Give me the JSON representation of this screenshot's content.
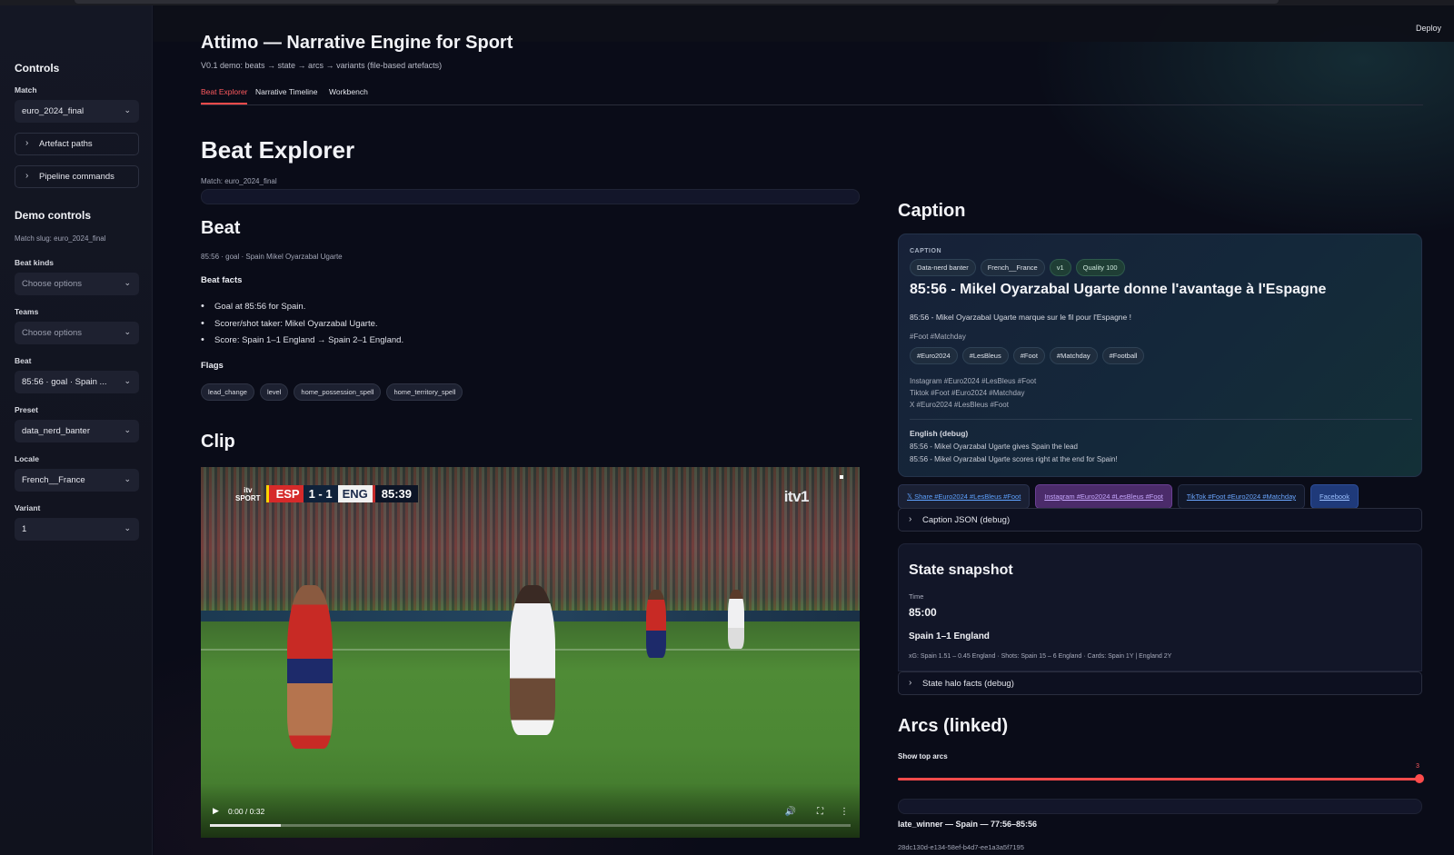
{
  "header": {
    "deploy_label": "Deploy"
  },
  "sidebar": {
    "controls_heading": "Controls",
    "match_label": "Match",
    "match_value": "euro_2024_final",
    "artefact_paths": "Artefact paths",
    "pipeline_commands": "Pipeline commands",
    "demo_heading": "Demo controls",
    "match_slug": "Match slug: euro_2024_final",
    "beat_kinds_label": "Beat kinds",
    "beat_kinds_placeholder": "Choose options",
    "teams_label": "Teams",
    "teams_placeholder": "Choose options",
    "beat_label": "Beat",
    "beat_value": "85:56 · goal · Spain ...",
    "preset_label": "Preset",
    "preset_value": "data_nerd_banter",
    "locale_label": "Locale",
    "locale_value": "French__France",
    "variant_label": "Variant",
    "variant_value": "1"
  },
  "app": {
    "title": "Attimo — Narrative Engine for Sport",
    "subtitle": "V0.1 demo: beats → state → arcs → variants (file-based artefacts)",
    "tabs": [
      "Beat Explorer",
      "Narrative Timeline",
      "Workbench"
    ],
    "active_tab": "Beat Explorer"
  },
  "explorer": {
    "heading": "Beat Explorer",
    "match_caption": "Match: euro_2024_final",
    "beat_heading": "Beat",
    "beat_caption": "85:56 · goal · Spain Mikel Oyarzabal Ugarte",
    "facts_label": "Beat facts",
    "facts": [
      "Goal at 85:56 for Spain.",
      "Scorer/shot taker: Mikel Oyarzabal Ugarte.",
      "Score: Spain 1–1 England → Spain 2–1 England."
    ],
    "flags_label": "Flags",
    "flags": [
      "lead_change",
      "level",
      "home_possession_spell",
      "home_territory_spell"
    ],
    "clip_heading": "Clip"
  },
  "video": {
    "brand_top": "itv",
    "brand_bottom": "SPORT",
    "team_home": "ESP",
    "score": "1 - 1",
    "team_away": "ENG",
    "clock": "85:39",
    "channel": "itv1",
    "time": "0:00 / 0:32",
    "progress": 0.11
  },
  "caption": {
    "heading": "Caption",
    "kicker": "CAPTION",
    "tags": [
      "Data-nerd banter",
      "French__France",
      "v1",
      "Quality 100"
    ],
    "title": "85:56 - Mikel Oyarzabal Ugarte donne l'avantage à l'Espagne",
    "body": "85:56 - Mikel Oyarzabal Ugarte marque sur le fil pour l'Espagne !",
    "hashline": "#Foot #Matchday",
    "hashtags": [
      "#Euro2024",
      "#LesBleus",
      "#Foot",
      "#Matchday",
      "#Football"
    ],
    "platforms": [
      "Instagram #Euro2024 #LesBleus #Foot",
      "Tiktok #Foot #Euro2024 #Matchday",
      "X #Euro2024 #LesBleus #Foot"
    ],
    "english_label": "English (debug)",
    "english": [
      "85:56 - Mikel Oyarzabal Ugarte gives Spain the lead",
      "85:56 - Mikel Oyarzabal Ugarte scores right at the end for Spain!"
    ],
    "share": {
      "x": "𝕏 Share #Euro2024 #LesBleus #Foot",
      "instagram": "Instagram #Euro2024 #LesBleus #Foot",
      "tiktok": "TikTok #Foot #Euro2024 #Matchday",
      "facebook": "Facebook"
    },
    "json_debug": "Caption JSON (debug)"
  },
  "state": {
    "heading": "State snapshot",
    "time_label": "Time",
    "time_value": "85:00",
    "score_line": "Spain 1–1 England",
    "stats": "xG: Spain 1.51 – 0.45 England · Shots: Spain 15 – 6 England · Cards: Spain 1Y | England 2Y",
    "halo_debug": "State halo facts (debug)"
  },
  "arcs": {
    "heading": "Arcs (linked)",
    "slider_label": "Show top arcs",
    "slider_value": "3",
    "arc_title": "late_winner — Spain — 77:56–85:56",
    "arc_id": "28dc130d-e134-58ef-b4d7-ee1a3a5f7195"
  },
  "colors": {
    "accent": "#ff4b4b",
    "background": "#0a0c18",
    "sidebar": "#141724"
  }
}
